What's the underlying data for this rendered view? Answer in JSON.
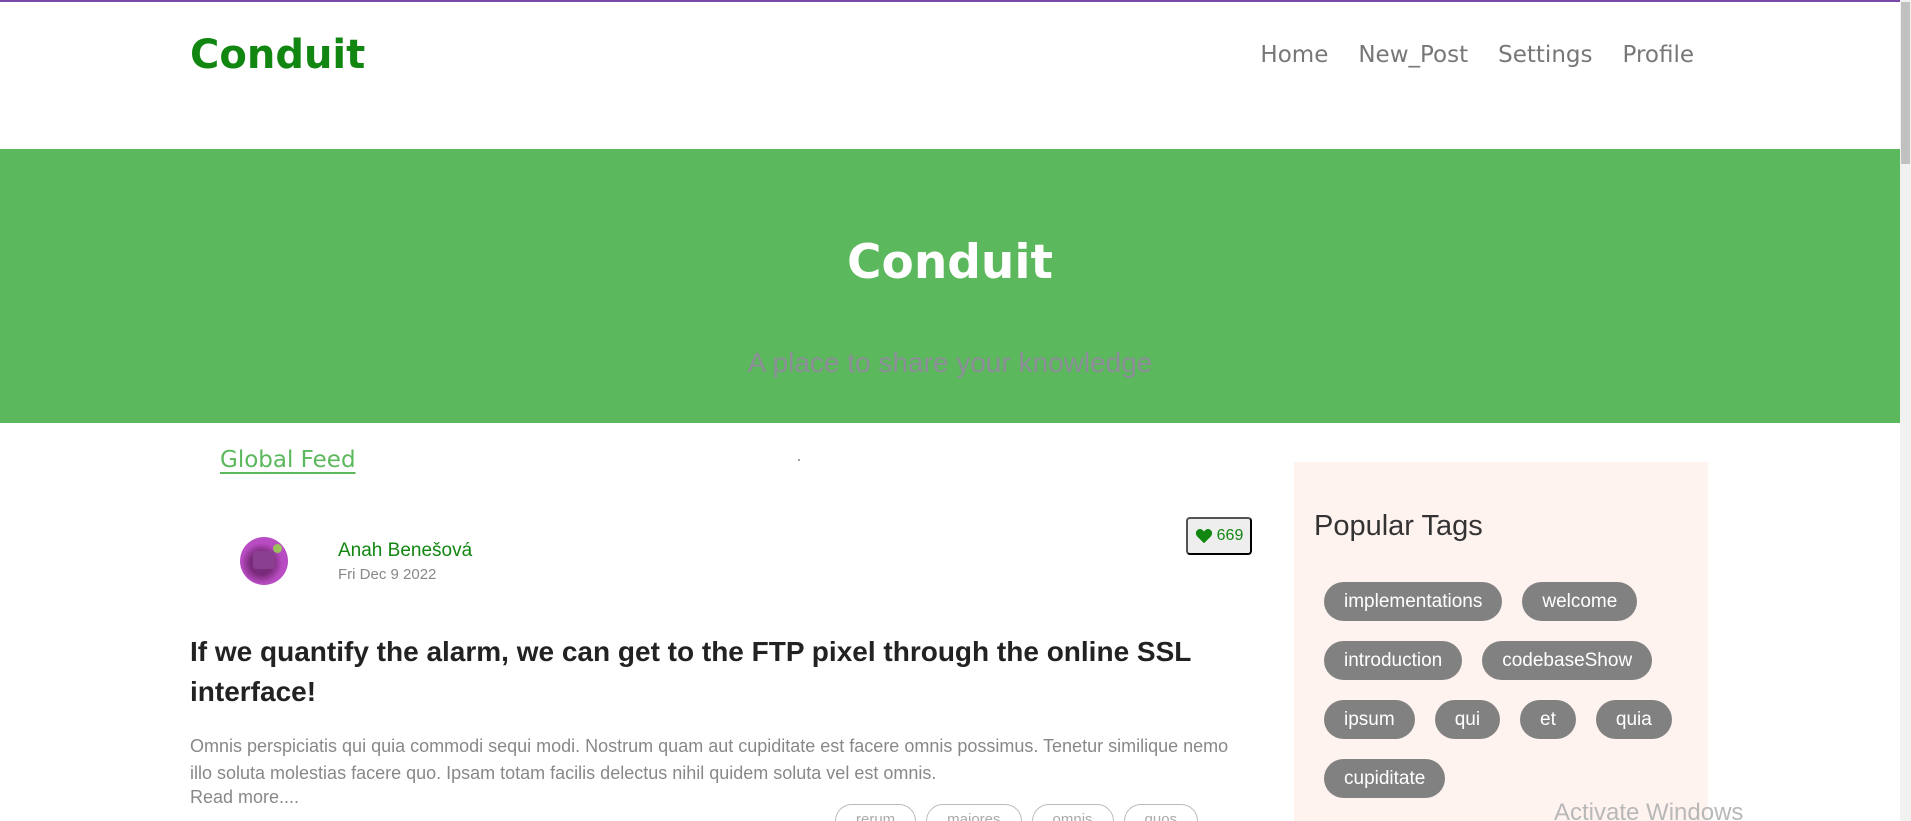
{
  "colors": {
    "brand": "#118611",
    "banner": "#5cb85c",
    "sidebar_bg": "#fff3ef",
    "tag_pill": "#818181"
  },
  "header": {
    "brand": "Conduit",
    "nav": [
      "Home",
      "New_Post",
      "Settings",
      "Profile"
    ]
  },
  "banner": {
    "title": "Conduit",
    "subtitle": "A place to share your knowledge"
  },
  "feed": {
    "tab_label": "Global Feed",
    "article": {
      "author": "Anah Benešová",
      "date": "Fri Dec 9 2022",
      "likes": "669",
      "title": "If we quantify the alarm, we can get to the FTP pixel through the online SSL interface!",
      "description": "Omnis perspiciatis qui quia commodi sequi modi. Nostrum quam aut cupiditate est facere omnis possimus. Tenetur similique nemo illo soluta molestias facere quo. Ipsam totam facilis delectus nihil quidem soluta vel est omnis.",
      "read_more": "Read more....",
      "tags": [
        "rerum",
        "maiores",
        "omnis",
        "quos"
      ],
      "avatar_icon": "avatar-image"
    }
  },
  "sidebar": {
    "title": "Popular Tags",
    "tags": [
      "implementations",
      "welcome",
      "introduction",
      "codebaseShow",
      "ipsum",
      "qui",
      "et",
      "quia",
      "cupiditate"
    ]
  },
  "watermark": "Activate Windows"
}
